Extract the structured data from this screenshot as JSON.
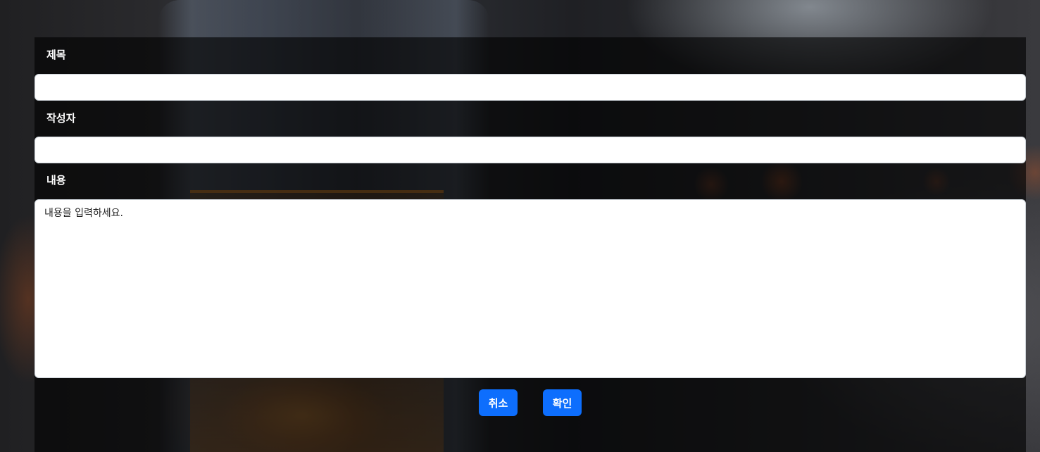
{
  "form": {
    "title_label": "제목",
    "title_value": "",
    "author_label": "작성자",
    "author_value": "",
    "content_label": "내용",
    "content_placeholder": "내용을 입력하세요.",
    "content_value": ""
  },
  "actions": {
    "cancel_label": "취소",
    "confirm_label": "확인"
  },
  "colors": {
    "button_primary": "#0d6efd",
    "panel_overlay": "rgba(0,0,0,0.62)",
    "label_text": "#ffffff"
  }
}
